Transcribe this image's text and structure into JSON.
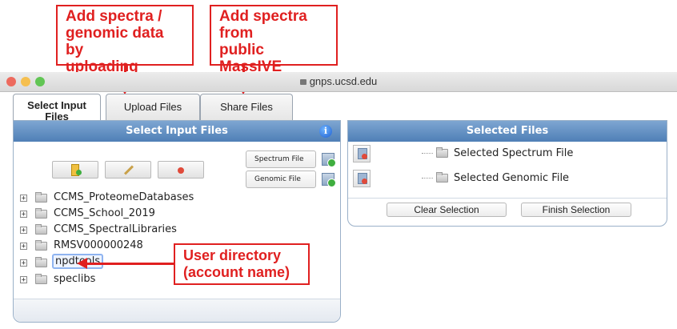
{
  "callouts": {
    "upload": "Add spectra /\ngenomic data by\nuploading",
    "share": "Add spectra from\npublic MassIVE\nDatasets",
    "user_dir": "User directory\n(account name)"
  },
  "browser": {
    "url": "gnps.ucsd.edu",
    "dot_colors": [
      "#ed6a5e",
      "#f5bf4f",
      "#61c554"
    ]
  },
  "tabs": [
    {
      "label": "Select Input\nFiles",
      "active": true
    },
    {
      "label": "Upload Files",
      "active": false
    },
    {
      "label": "Share Files",
      "active": false
    }
  ],
  "left_panel": {
    "title": "Select Input Files",
    "info_icon": "i",
    "toolbar": [
      "add-folder-icon",
      "rename-icon",
      "delete-icon"
    ],
    "spectrum_button": "Spectrum File",
    "genomic_button": "Genomic File",
    "tree": [
      {
        "label": "CCMS_ProteomeDatabases",
        "selected": false
      },
      {
        "label": "CCMS_School_2019",
        "selected": false
      },
      {
        "label": "CCMS_SpectralLibraries",
        "selected": false
      },
      {
        "label": "RMSV000000248",
        "selected": false
      },
      {
        "label": "npdtools",
        "selected": true
      },
      {
        "label": "speclibs",
        "selected": false
      }
    ]
  },
  "right_panel": {
    "title": "Selected Files",
    "selected_spectrum": "Selected Spectrum File",
    "selected_genomic": "Selected Genomic File",
    "clear_button": "Clear Selection",
    "finish_button": "Finish Selection"
  },
  "colors": {
    "callout": "#e02020",
    "header_blue": "#4f7fb6"
  }
}
